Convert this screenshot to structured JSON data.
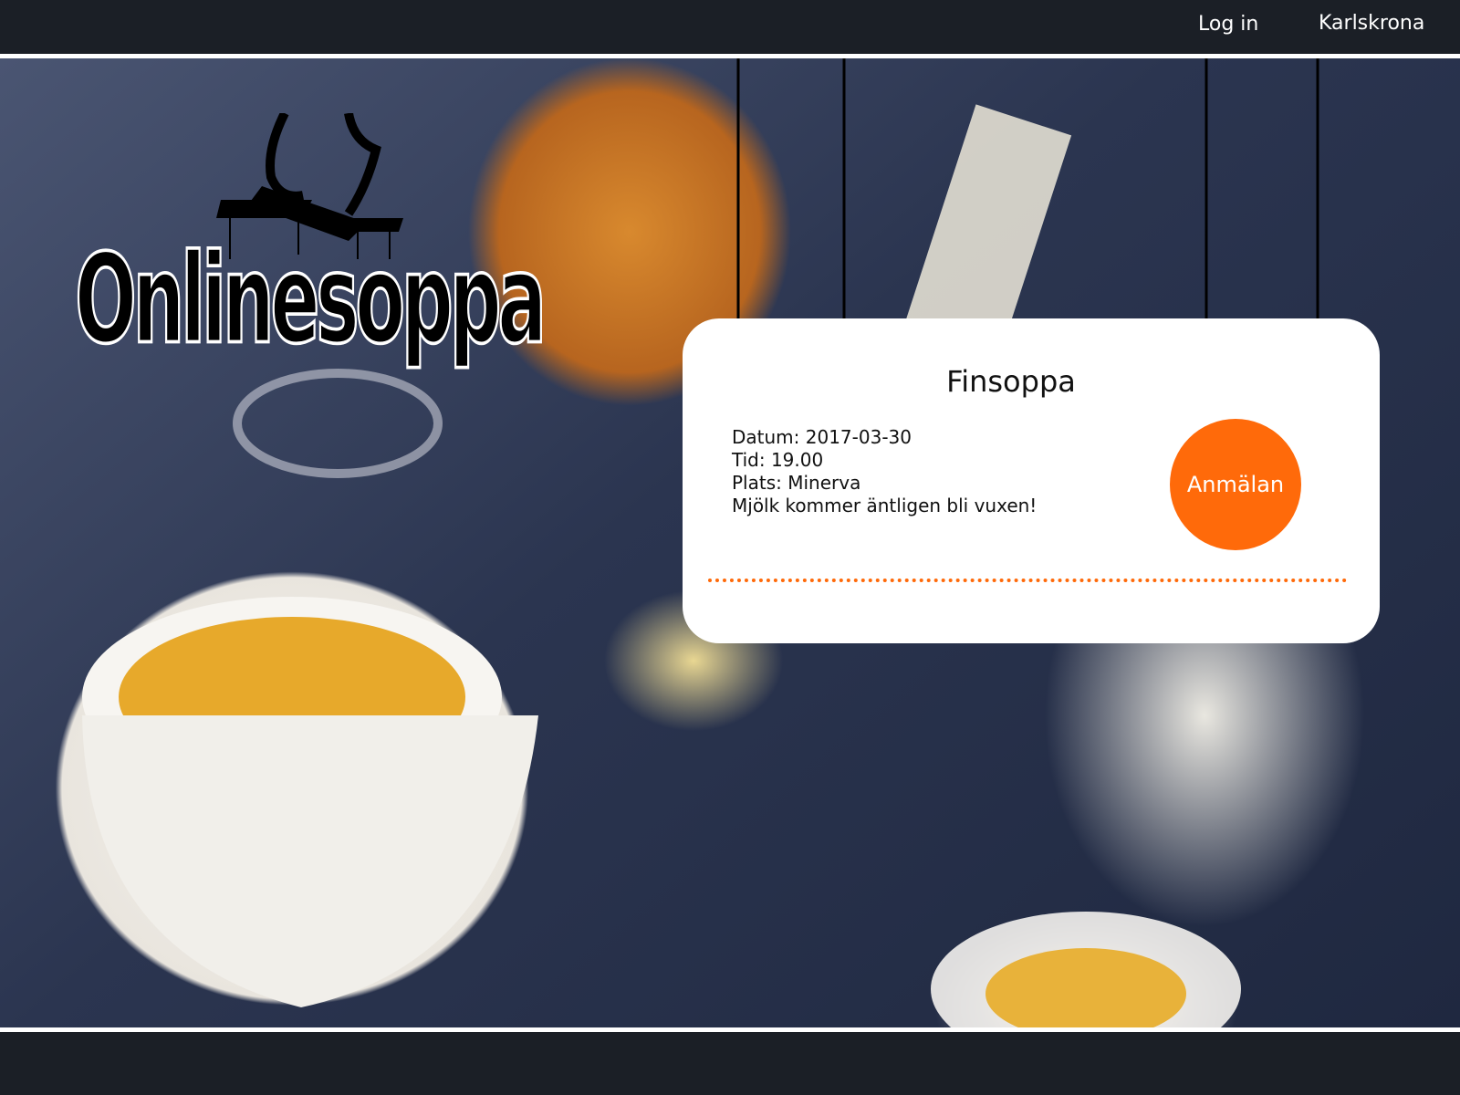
{
  "nav": {
    "login_label": "Log in",
    "city_label": "Karlskrona"
  },
  "logo": {
    "text": "Onlinesoppa"
  },
  "event": {
    "title": "Finsoppa",
    "date": "Datum: 2017-03-30",
    "time": "Tid: 19.00",
    "place": "Plats: Minerva",
    "description": "Mjölk kommer äntligen bli vuxen!",
    "signup_label": "Anmälan"
  },
  "colors": {
    "accent": "#ff6a0a",
    "bar": "#1b1f26",
    "card": "#ffffff"
  }
}
